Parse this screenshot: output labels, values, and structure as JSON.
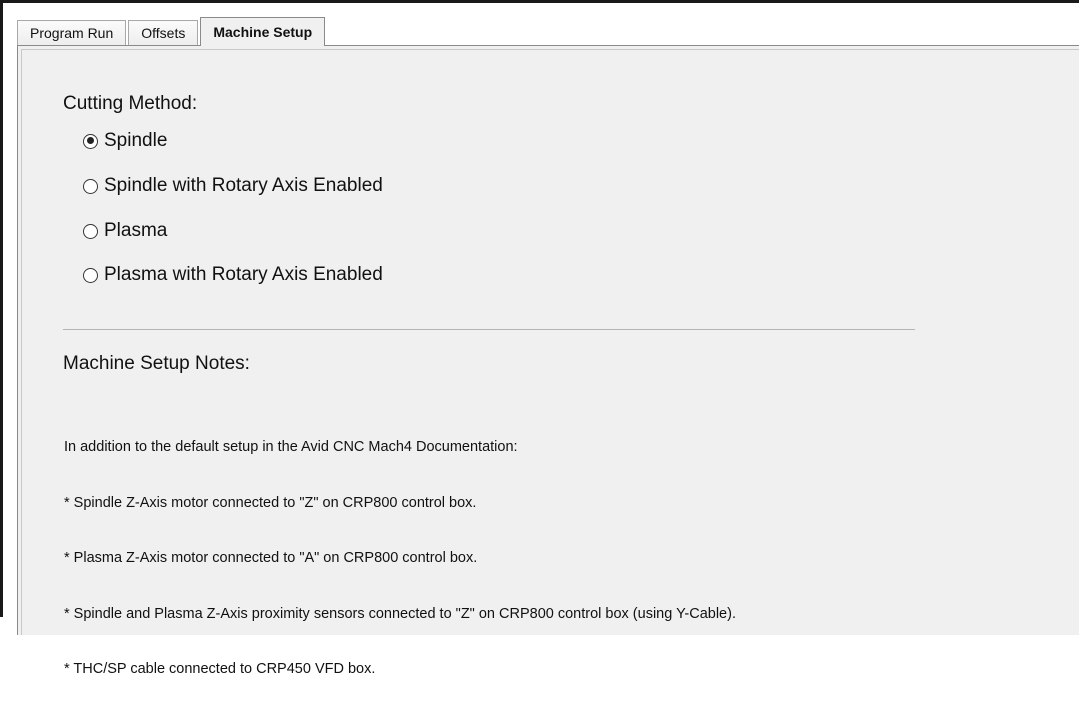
{
  "tabs": [
    {
      "label": "Program Run",
      "active": false
    },
    {
      "label": "Offsets",
      "active": false
    },
    {
      "label": "Machine Setup",
      "active": true
    }
  ],
  "cutting_method": {
    "title": "Cutting Method:",
    "selected": "Spindle",
    "options": [
      {
        "label": "Spindle",
        "checked": true
      },
      {
        "label": "Spindle with Rotary Axis Enabled",
        "checked": false
      },
      {
        "label": "Plasma",
        "checked": false
      },
      {
        "label": "Plasma with Rotary Axis Enabled",
        "checked": false
      }
    ]
  },
  "notes": {
    "title": "Machine Setup Notes:",
    "lines": [
      "In addition to the default setup in the Avid CNC Mach4 Documentation:",
      "* Spindle Z-Axis motor connected to \"Z\" on CRP800 control box.",
      "* Plasma Z-Axis motor connected to \"A\" on CRP800 control box.",
      "* Spindle and Plasma Z-Axis proximity sensors connected to \"Z\" on CRP800 control box (using Y-Cable).",
      "* THC/SP cable connected to CRP450 VFD box."
    ]
  },
  "colors": {
    "panel_bg": "#f0f0f0",
    "frame_border": "#1a1a1a"
  }
}
